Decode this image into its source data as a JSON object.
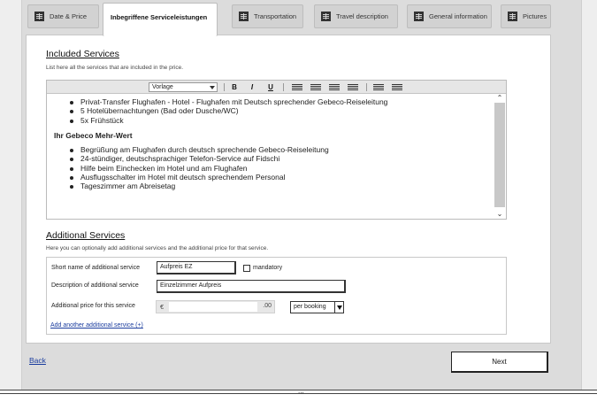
{
  "tabs": [
    {
      "label": "Date & Price",
      "active": false
    },
    {
      "label": "Inbegriffene Serviceleistungen",
      "active": true
    },
    {
      "label": "Transportation",
      "active": false
    },
    {
      "label": "Travel description",
      "active": false
    },
    {
      "label": "General information",
      "active": false
    },
    {
      "label": "Pictures",
      "active": false
    }
  ],
  "included": {
    "title": "Included Services",
    "description": "List here all the services that are included in the price.",
    "toolbar": {
      "style_select": "Vorlage",
      "bold": "B",
      "italic": "I",
      "underline": "U"
    },
    "list1": [
      "Privat-Transfer Flughafen - Hotel - Flughafen mit Deutsch sprechender Gebeco-Reiseleitung",
      "5 Hotelübernachtungen (Bad oder Dusche/WC)",
      "5x Frühstück"
    ],
    "subheading": "Ihr Gebeco Mehr-Wert",
    "list2": [
      "Begrüßung am Flughafen durch deutsch sprechende Gebeco-Reiseleitung",
      "24-stündiger, deutschsprachiger Telefon-Service auf Fidschi",
      "Hilfe beim Einchecken im Hotel und am Flughafen",
      "Ausflugsschalter im Hotel mit deutsch sprechendem Personal",
      "Tageszimmer am Abreisetag"
    ]
  },
  "additional": {
    "title": "Additional Services",
    "description": "Here you can optionally add additional services and the additional price for that service.",
    "short_name_label": "Short name of additional service",
    "short_name_value": "Aufpreis EZ",
    "mandatory_label": "mandatory",
    "description_label": "Description of additional service",
    "description_value": "Einzelzimmer Aufpreis",
    "price_label": "Additional price for this service",
    "currency": "€",
    "cents": ".00",
    "price_unit": "per booking",
    "add_link": "Add another additional service (+)"
  },
  "footer": {
    "back_label": "Back",
    "next_label": "Next",
    "dots": "..."
  }
}
